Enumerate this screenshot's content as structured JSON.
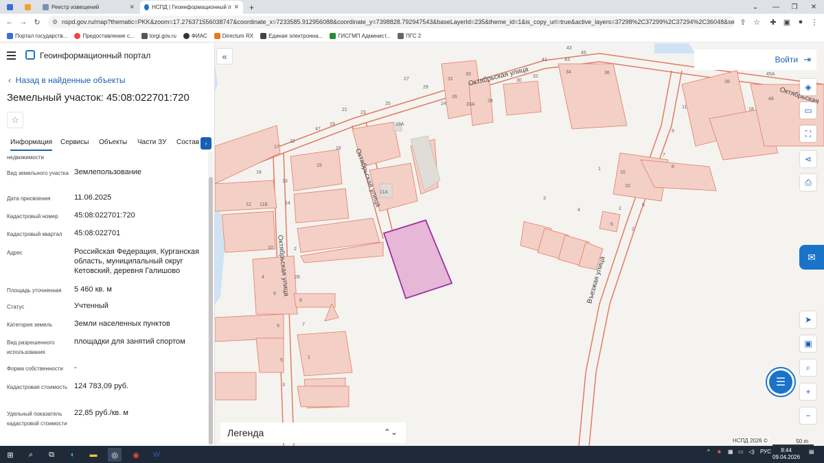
{
  "browser": {
    "tabs": [
      {
        "label": "",
        "icon": "gosuslugi-icon"
      },
      {
        "label": "",
        "icon": "yandex-icon"
      },
      {
        "label": "Реестр извещений",
        "icon": "emblem-icon"
      },
      {
        "label": "НСПД | Геоинформационный п",
        "icon": "nspd-icon"
      }
    ],
    "url": "nspd.gov.ru/map?thematic=PKK&zoom=17.276371556038747&coordinate_x=7233585.912956088&coordinate_y=7398828.792947543&baseLayerId=235&theme_id=1&is_copy_url=true&active_layers=37298%2C37299%2C37294%2C36048&selectedCa...",
    "bookmarks": [
      "Портал государств...",
      "Предоставление с...",
      "torgi.gov.ru",
      "ФИАС",
      "Directum RX",
      "Единая электронна...",
      "ГИСГМП Админист...",
      "ПГС 2"
    ]
  },
  "portal": {
    "title": "Геоинформационный портал",
    "back_label": "Назад в найденные объекты",
    "object_title": "Земельный участок: 45:08:022701:720",
    "tabs": [
      "Информация",
      "Сервисы",
      "Объекты",
      "Части ЗУ",
      "Состав"
    ],
    "properties": [
      {
        "label": "недвижимости",
        "value": ""
      },
      {
        "label": "Вид земельного участка",
        "value": "Землепользование"
      },
      {
        "label": "Дата присвоения",
        "value": "11.06.2025"
      },
      {
        "label": "Кадастровый номер",
        "value": "45:08:022701:720"
      },
      {
        "label": "Кадастровый квартал",
        "value": "45:08:022701"
      },
      {
        "label": "Адрес",
        "value": "Российская Федерация, Курганская область, муниципальный округ Кетовский, деревня Галишово"
      },
      {
        "label": "Площадь уточненная",
        "value": "5 460 кв. м"
      },
      {
        "label": "Статус",
        "value": "Учтенный"
      },
      {
        "label": "Категория земель",
        "value": "Земли населенных пунктов"
      },
      {
        "label": "Вид разрешенного использования",
        "value": "площадки для занятий спортом"
      },
      {
        "label": "Форма собственности",
        "value": "-"
      },
      {
        "label": "Кадастровая стоимость",
        "value": "124 783,09 руб."
      },
      {
        "label": "Удельный показатель кадастровой стоимости",
        "value": "22,85 руб./кв. м"
      }
    ]
  },
  "map": {
    "login_label": "Войти",
    "legend_label": "Легенда",
    "copyright": "НСПД 2026 ©",
    "scale_label": "50 m",
    "streets": [
      "Октябрьская улица",
      "Октябрьская улица",
      "Октябрьская улица",
      "Въезжая улица",
      "Октябрьская"
    ],
    "house_numbers": [
      "43",
      "45",
      "43",
      "41",
      "34",
      "36",
      "45А",
      "27",
      "29",
      "31",
      "33",
      "32",
      "30",
      "38",
      "21",
      "23",
      "25",
      "24",
      "26",
      "33А",
      "28",
      "18",
      "48",
      "47",
      "19",
      "19А",
      "22",
      "17",
      "15",
      "16",
      "18",
      "13",
      "14",
      "12",
      "11Б",
      "11А",
      "28",
      "8",
      "6",
      "7",
      "4",
      "9",
      "5",
      "3",
      "1",
      "2",
      "10",
      "11",
      "10",
      "9",
      "7",
      "8",
      "6",
      "5",
      "4",
      "3",
      "2",
      "1",
      "2",
      "10"
    ]
  },
  "taskbar": {
    "time": "8:44",
    "date": "09.04.2026",
    "lang": "РУС"
  }
}
